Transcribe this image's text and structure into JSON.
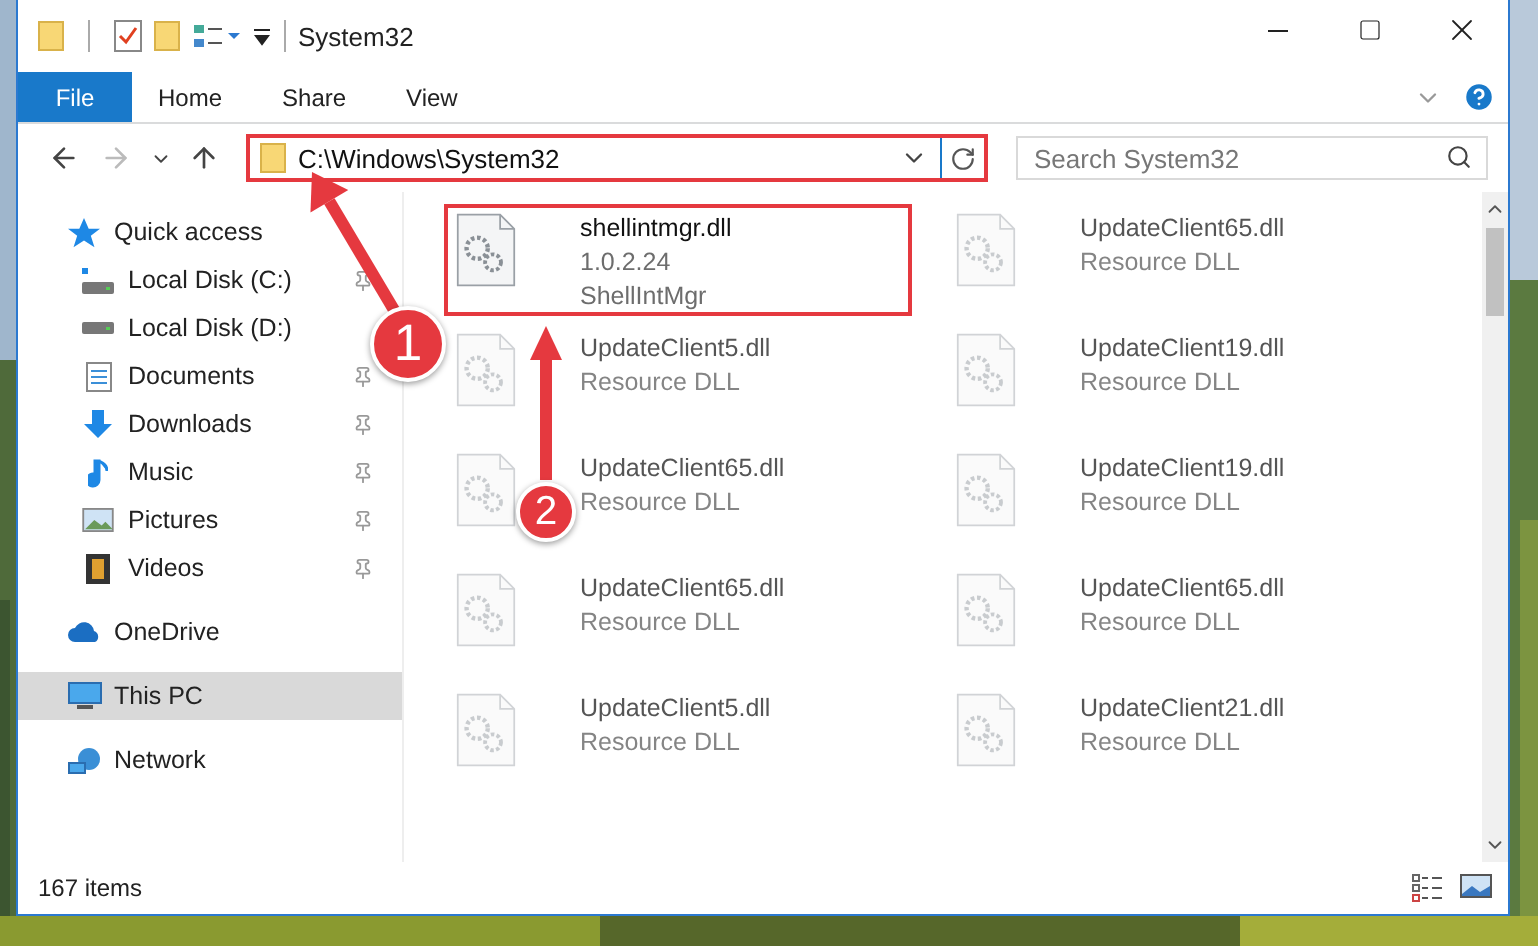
{
  "window": {
    "title": "System32"
  },
  "ribbon": {
    "file_button": "File",
    "tabs": [
      "Home",
      "Share",
      "View"
    ]
  },
  "address_bar": {
    "path": "C:\\Windows\\System32",
    "highlighted": true
  },
  "search": {
    "placeholder": "Search System32"
  },
  "sidebar": {
    "items": [
      {
        "label": "Quick access",
        "kind": "star",
        "selected": false,
        "children": [
          {
            "label": "Local Disk (C:)",
            "kind": "drive-windows",
            "pinned": true,
            "selected": false
          },
          {
            "label": "Local Disk (D:)",
            "kind": "drive",
            "pinned": false,
            "selected": false
          },
          {
            "label": "Documents",
            "kind": "documents",
            "pinned": true,
            "selected": false
          },
          {
            "label": "Downloads",
            "kind": "downloads",
            "pinned": true,
            "selected": false
          },
          {
            "label": "Music",
            "kind": "music",
            "pinned": true,
            "selected": false
          },
          {
            "label": "Pictures",
            "kind": "pictures",
            "pinned": true,
            "selected": false
          },
          {
            "label": "Videos",
            "kind": "videos",
            "pinned": true,
            "selected": false
          }
        ]
      },
      {
        "label": "OneDrive",
        "kind": "cloud",
        "selected": false
      },
      {
        "label": "This PC",
        "kind": "computer",
        "selected": true
      },
      {
        "label": "Network",
        "kind": "network",
        "selected": false
      }
    ]
  },
  "files": [
    {
      "name": "shellintmgr.dll",
      "details": [
        "1.0.2.24",
        "ShellIntMgr"
      ],
      "highlighted": true,
      "blurred": false
    },
    {
      "name": "UpdateClient65.dll",
      "details": [
        "Resource DLL"
      ],
      "highlighted": false,
      "blurred": true
    },
    {
      "name": "UpdateClient5.dll",
      "details": [
        "Resource DLL"
      ],
      "highlighted": false,
      "blurred": true
    },
    {
      "name": "UpdateClient19.dll",
      "details": [
        "Resource DLL"
      ],
      "highlighted": false,
      "blurred": true
    },
    {
      "name": "UpdateClient65.dll",
      "details": [
        "Resource DLL"
      ],
      "highlighted": false,
      "blurred": true
    },
    {
      "name": "UpdateClient19.dll",
      "details": [
        "Resource DLL"
      ],
      "highlighted": false,
      "blurred": true
    },
    {
      "name": "UpdateClient65.dll",
      "details": [
        "Resource DLL"
      ],
      "highlighted": false,
      "blurred": true
    },
    {
      "name": "UpdateClient65.dll",
      "details": [
        "Resource DLL"
      ],
      "highlighted": false,
      "blurred": true
    },
    {
      "name": "UpdateClient5.dll",
      "details": [
        "Resource DLL"
      ],
      "highlighted": false,
      "blurred": true
    },
    {
      "name": "UpdateClient21.dll",
      "details": [
        "Resource DLL"
      ],
      "highlighted": false,
      "blurred": true
    }
  ],
  "annotations": [
    {
      "label": "1"
    },
    {
      "label": "2"
    }
  ],
  "status_bar": {
    "item_count": "167 items"
  }
}
